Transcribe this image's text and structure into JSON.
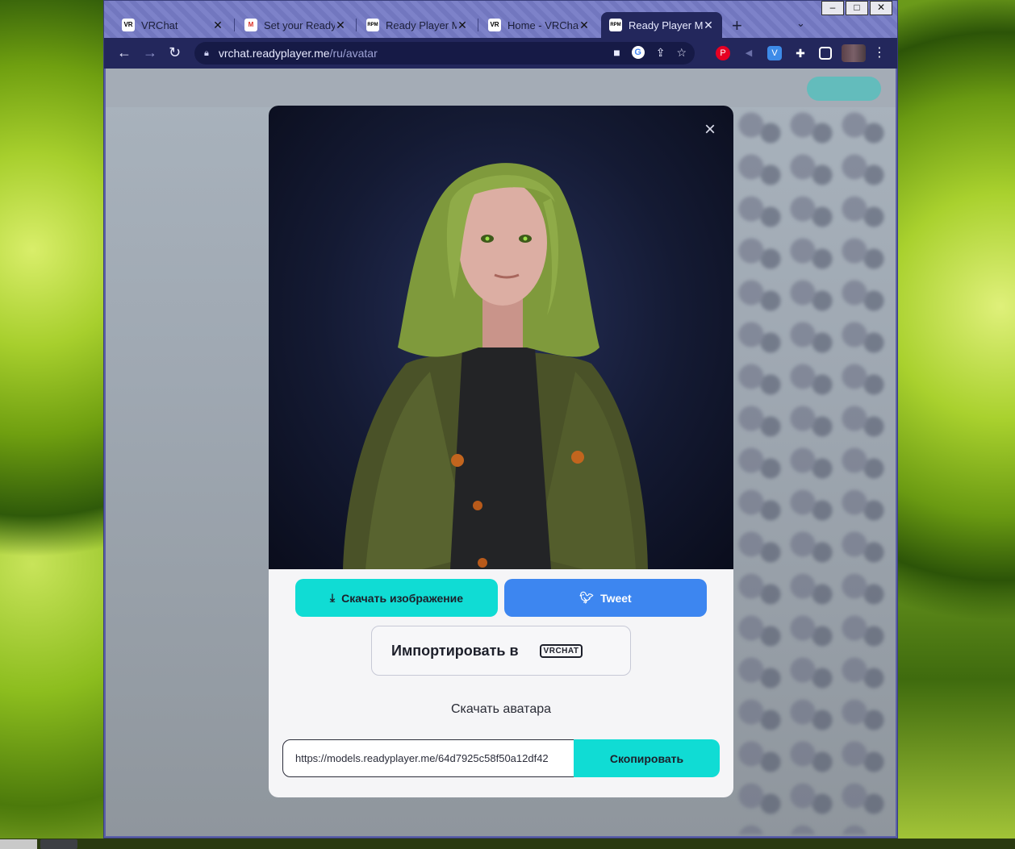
{
  "browser": {
    "tabs": [
      {
        "title": "VRChat",
        "favicon": "VR",
        "active": false
      },
      {
        "title": "Set your Ready",
        "favicon": "M",
        "active": false
      },
      {
        "title": "Ready Player Me",
        "favicon": "RPM",
        "active": false
      },
      {
        "title": "Home - VRChat",
        "favicon": "VR",
        "active": false
      },
      {
        "title": "Ready Player Me",
        "favicon": "RPM",
        "active": true
      }
    ],
    "new_tab_label": "+",
    "url_host": "vrchat.readyplayer.me",
    "url_path": "/ru/avatar",
    "window_controls": {
      "minimize": "–",
      "maximize": "□",
      "close": "✕"
    },
    "toolbar_icons": [
      "back-icon",
      "forward-icon",
      "reload-icon",
      "lock-icon",
      "camera-icon",
      "google-icon",
      "share-icon",
      "bookmark-star-icon",
      "pinterest-icon",
      "extension-v-icon",
      "puzzle-icon",
      "sidebar-icon",
      "menu-icon"
    ]
  },
  "modal": {
    "close_label": "×",
    "download_image_label": "Скачать изображение",
    "tweet_label": "Tweet",
    "import_label": "Импортировать в",
    "vrchat_logo_text": "VRCHAT",
    "download_avatar_label": "Скачать аватара",
    "avatar_url": "https://models.readyplayer.me/64d7925c58f50a12df42",
    "copy_label": "Скопировать",
    "accent_color": "#10dcd4",
    "twitter_color": "#3d86f0"
  }
}
